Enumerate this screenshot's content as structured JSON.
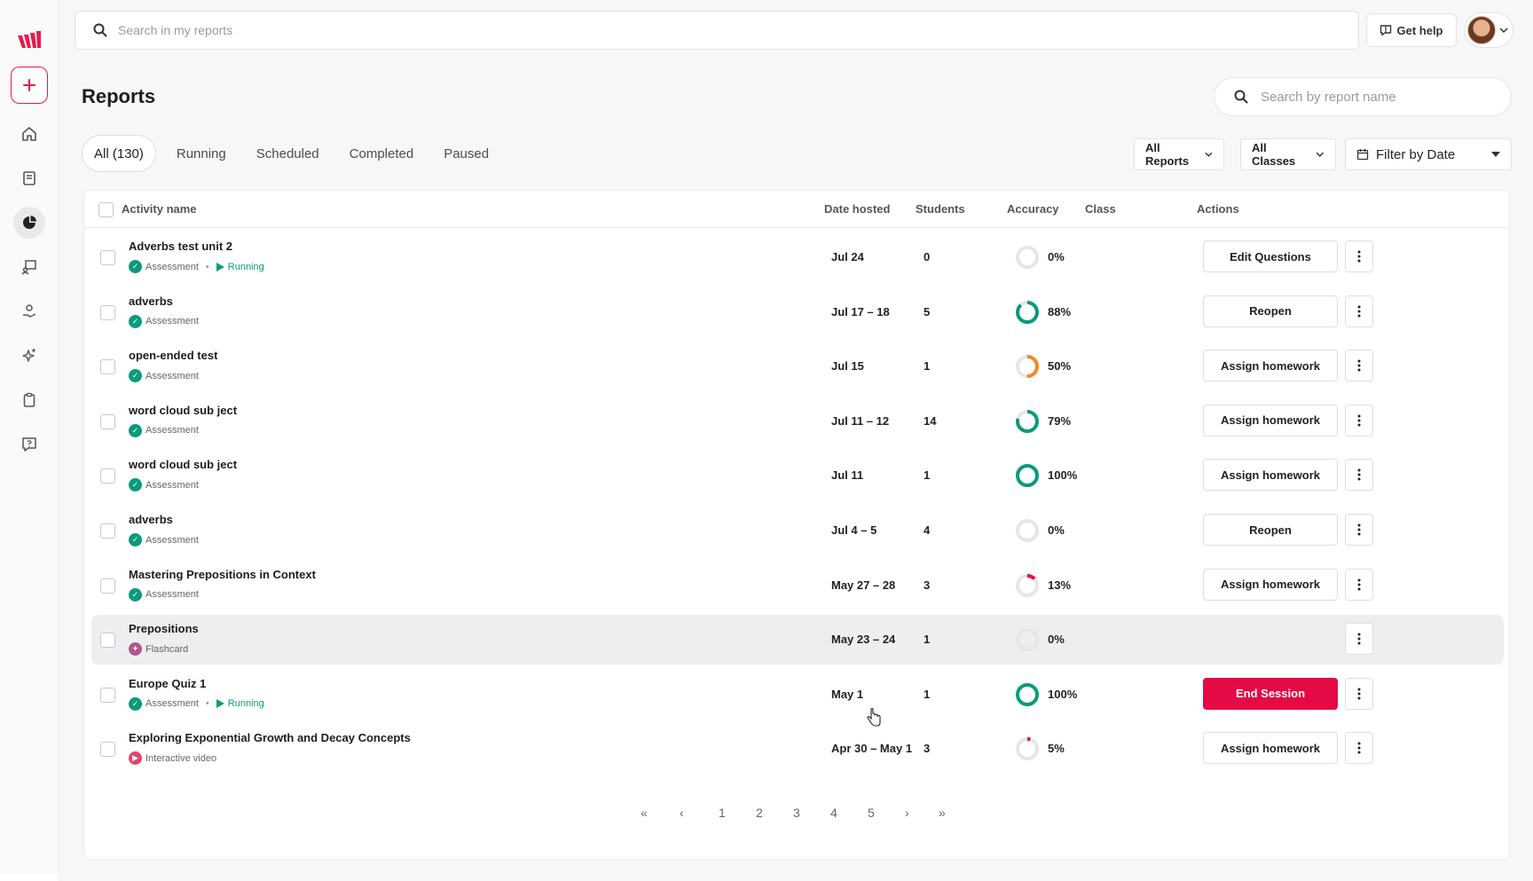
{
  "top_search": {
    "placeholder": "Search in my reports"
  },
  "header": {
    "get_help": "Get help"
  },
  "page": {
    "title": "Reports",
    "report_search_placeholder": "Search by report name"
  },
  "tabs": [
    {
      "label": "All (130)",
      "active": true
    },
    {
      "label": "Running",
      "active": false
    },
    {
      "label": "Scheduled",
      "active": false
    },
    {
      "label": "Completed",
      "active": false
    },
    {
      "label": "Paused",
      "active": false
    }
  ],
  "filters": {
    "reports": "All Reports",
    "classes": "All Classes",
    "date": "Filter by Date"
  },
  "table": {
    "columns": {
      "activity": "Activity name",
      "date": "Date hosted",
      "students": "Students",
      "accuracy": "Accuracy",
      "class": "Class",
      "actions": "Actions"
    },
    "rows": [
      {
        "name": "Adverbs test unit 2",
        "type": "Assessment",
        "status": "Running",
        "date": "Jul 24",
        "students": "0",
        "accuracy": "0%",
        "acc_value": 0,
        "action": "Edit Questions"
      },
      {
        "name": "adverbs",
        "type": "Assessment",
        "status": "",
        "date": "Jul 17 – 18",
        "students": "5",
        "accuracy": "88%",
        "acc_value": 88,
        "action": "Reopen"
      },
      {
        "name": "open-ended test",
        "type": "Assessment",
        "status": "",
        "date": "Jul 15",
        "students": "1",
        "accuracy": "50%",
        "acc_value": 50,
        "action": "Assign homework"
      },
      {
        "name": "word cloud sub ject",
        "type": "Assessment",
        "status": "",
        "date": "Jul 11 – 12",
        "students": "14",
        "accuracy": "79%",
        "acc_value": 79,
        "action": "Assign homework"
      },
      {
        "name": "word cloud sub ject",
        "type": "Assessment",
        "status": "",
        "date": "Jul 11",
        "students": "1",
        "accuracy": "100%",
        "acc_value": 100,
        "action": "Assign homework"
      },
      {
        "name": "adverbs",
        "type": "Assessment",
        "status": "",
        "date": "Jul 4 – 5",
        "students": "4",
        "accuracy": "0%",
        "acc_value": 0,
        "action": "Reopen"
      },
      {
        "name": "Mastering Prepositions in Context",
        "type": "Assessment",
        "status": "",
        "date": "May 27 – 28",
        "students": "3",
        "accuracy": "13%",
        "acc_value": 13,
        "action": "Assign homework"
      },
      {
        "name": "Prepositions",
        "type": "Flashcard",
        "status": "",
        "date": "May 23 – 24",
        "students": "1",
        "accuracy": "0%",
        "acc_value": 0,
        "action": ""
      },
      {
        "name": "Europe Quiz 1",
        "type": "Assessment",
        "status": "Running",
        "date": "May 1",
        "students": "1",
        "accuracy": "100%",
        "acc_value": 100,
        "action": "End Session"
      },
      {
        "name": "Exploring Exponential Growth and Decay Concepts",
        "type": "Interactive video",
        "status": "",
        "date": "Apr 30 – May 1",
        "students": "3",
        "accuracy": "5%",
        "acc_value": 5,
        "action": "Assign homework"
      }
    ]
  },
  "pagination": [
    "«",
    "‹",
    "1",
    "2",
    "3",
    "4",
    "5",
    "›",
    "»"
  ],
  "colors": {
    "brand": "#e9194b",
    "success": "#0b9a7b",
    "warning": "#f08a24",
    "low": "#e0143c",
    "flashcard": "#b0578d",
    "video": "#e2456c"
  }
}
